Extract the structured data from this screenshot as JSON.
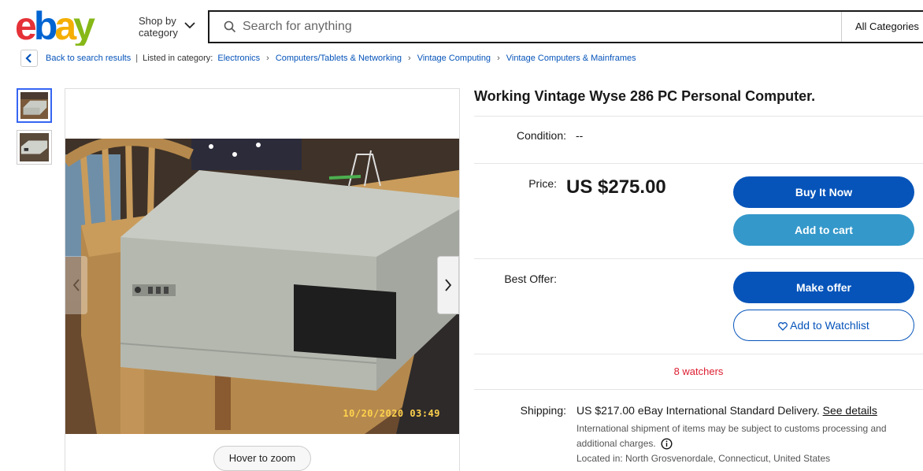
{
  "header": {
    "logo_text": "ebay",
    "shop_by_line1": "Shop by",
    "shop_by_line2": "category",
    "search_placeholder": "Search for anything",
    "category_select": "All Categories"
  },
  "breadcrumb": {
    "back_label": "Back to search results",
    "listed_in": "Listed in category:",
    "items": [
      "Electronics",
      "Computers/Tablets & Networking",
      "Vintage Computing",
      "Vintage Computers & Mainframes"
    ]
  },
  "gallery": {
    "timestamp": "10/20/2020 03:49",
    "hover_zoom": "Hover to zoom"
  },
  "listing": {
    "title": "Working Vintage Wyse 286 PC Personal Computer.",
    "condition_label": "Condition:",
    "condition_value": "--",
    "price_label": "Price:",
    "price": "US $275.00",
    "buy_now": "Buy It Now",
    "add_to_cart": "Add to cart",
    "best_offer_label": "Best Offer:",
    "make_offer": "Make offer",
    "add_to_watchlist": "Add to Watchlist",
    "watchers": "8 watchers"
  },
  "shipping": {
    "label": "Shipping:",
    "main": "US $217.00 eBay International Standard Delivery.",
    "see_details": "See details",
    "note": "International shipment of items may be subject to customs processing and additional charges.",
    "located": "Located in: North Grosvenordale, Connecticut, United States"
  },
  "colors": {
    "brand_red": "#e53238",
    "brand_blue": "#0064d2",
    "brand_yellow": "#f5af02",
    "brand_green": "#86b817",
    "primary_button": "#0654ba",
    "secondary_button": "#3498ca",
    "watchers": "#dd1e31"
  },
  "icons": [
    "search-icon",
    "chevron-down-icon",
    "back-arrow-icon",
    "chevron-left-icon",
    "chevron-right-icon",
    "heart-icon",
    "info-icon"
  ]
}
